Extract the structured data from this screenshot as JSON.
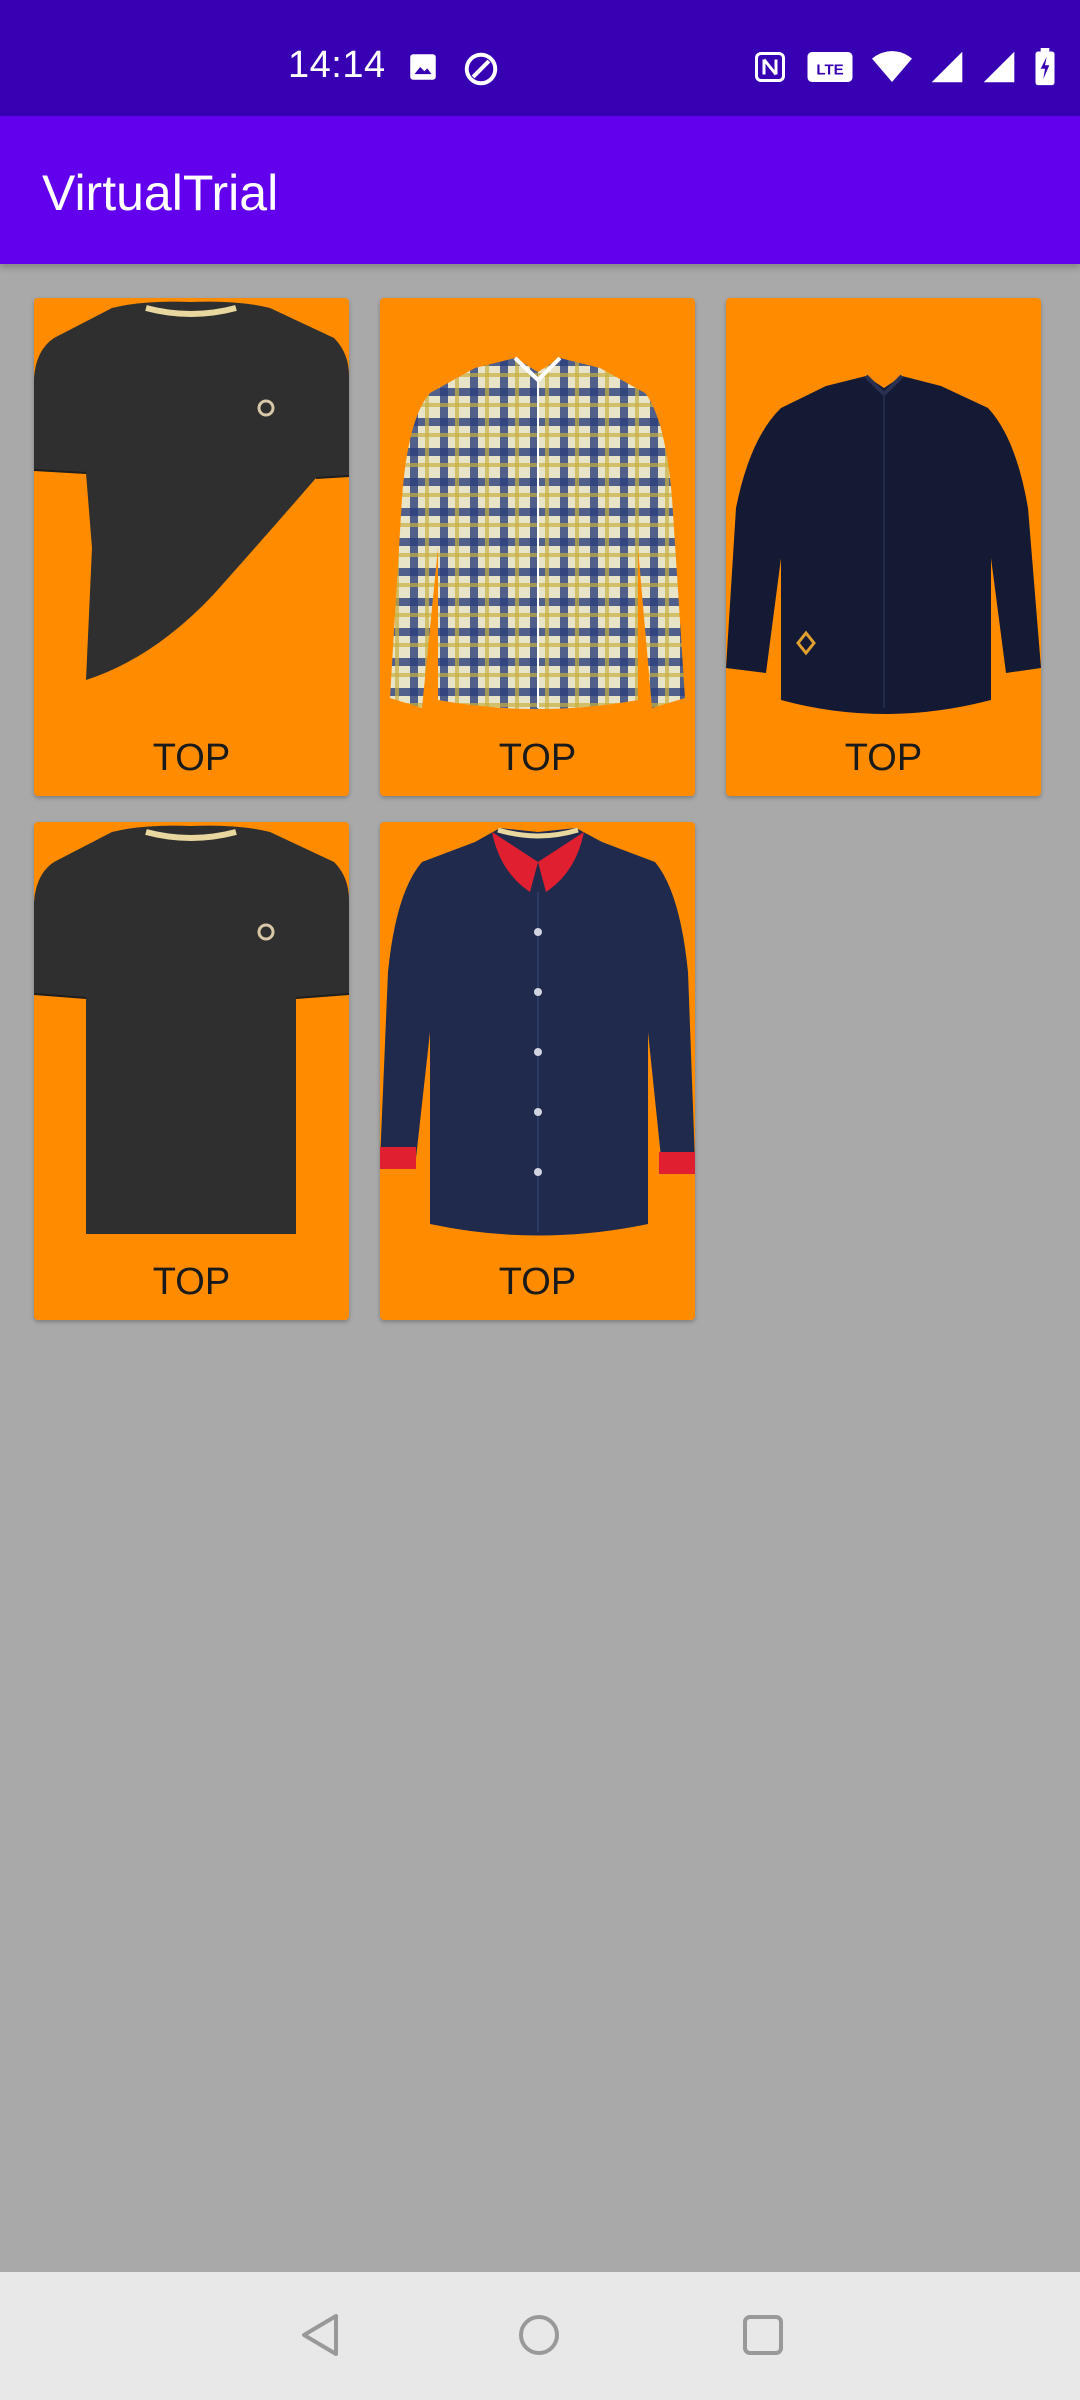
{
  "status_bar": {
    "time": "14:14",
    "icons_left": [
      "image-icon",
      "data-saver-icon"
    ],
    "icons_right": [
      "nfc-icon",
      "volte-icon",
      "wifi-icon",
      "signal-icon",
      "signal-icon",
      "battery-charging-icon"
    ]
  },
  "app_bar": {
    "title": "VirtualTrial"
  },
  "items": [
    {
      "label": "TOP",
      "image": "black-tshirt-icon"
    },
    {
      "label": "TOP",
      "image": "plaid-shirt-icon"
    },
    {
      "label": "TOP",
      "image": "navy-shirt-icon"
    },
    {
      "label": "TOP",
      "image": "black-tshirt-icon"
    },
    {
      "label": "TOP",
      "image": "navy-red-collar-shirt-icon"
    }
  ],
  "nav_bar": {
    "buttons": [
      "back-icon",
      "home-icon",
      "recents-icon"
    ]
  },
  "colors": {
    "status_bar": "#3700b3",
    "app_bar": "#6200ee",
    "card": "#ff8c00",
    "background": "#a9a9a9"
  }
}
